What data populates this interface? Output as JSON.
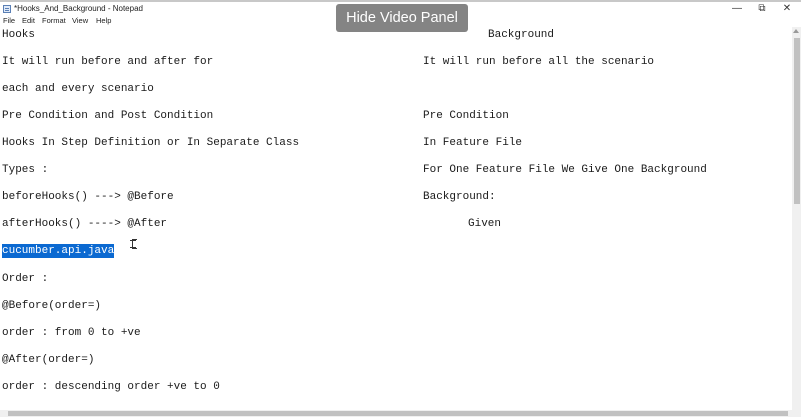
{
  "window": {
    "title": "*Hooks_And_Background - Notepad",
    "controls": {
      "minimize": "—",
      "maximize": "⧉",
      "close": "✕"
    }
  },
  "menu": [
    "File",
    "Edit",
    "Format",
    "View",
    "Help"
  ],
  "overlay_button": "Hide Video Panel",
  "editor": {
    "left_col": [
      "Hooks",
      "It will run before and after for",
      "each and every scenario",
      "Pre Condition and Post Condition",
      "Hooks In Step Definition or In Separate Class",
      "Types :",
      "beforeHooks() ---> @Before",
      "afterHooks() ----> @After",
      "cucumber.api.java",
      "Order :",
      "@Before(order=)",
      "order : from 0 to +ve",
      "@After(order=)",
      "order : descending order +ve to 0"
    ],
    "right_col": [
      "Background",
      "It will run before all the scenario",
      "Pre Condition",
      "In Feature File",
      "For One Feature File We Give One Background",
      "Background:",
      "Given"
    ],
    "selected_text": "cucumber.api.java"
  },
  "colors": {
    "selection": "#0b69d1",
    "overlay": "#696969"
  }
}
